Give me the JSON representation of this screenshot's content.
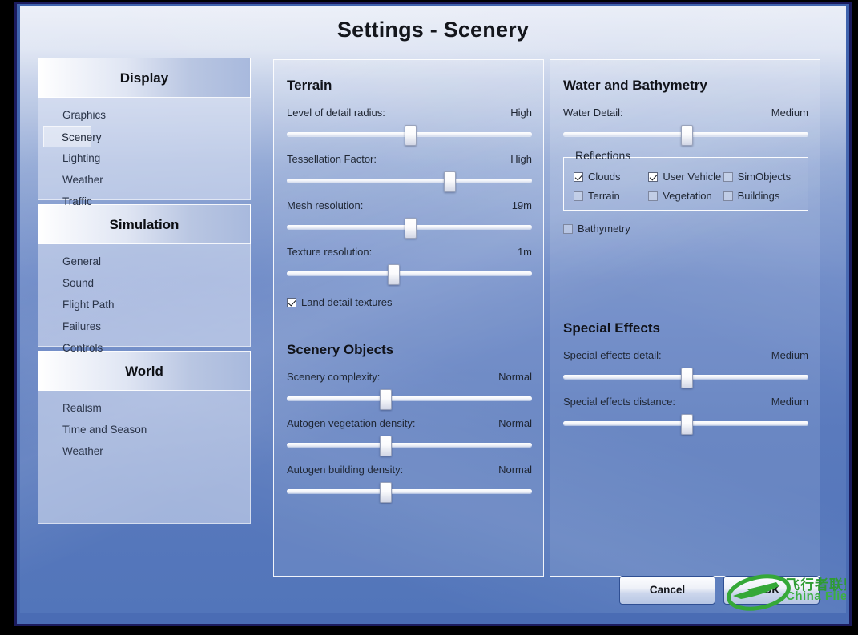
{
  "window": {
    "title": "Settings - Scenery"
  },
  "sidebar": {
    "groups": [
      {
        "header": "Display",
        "items": [
          {
            "label": "Graphics",
            "selected": false
          },
          {
            "label": "Scenery",
            "selected": true
          },
          {
            "label": "Lighting",
            "selected": false
          },
          {
            "label": "Weather",
            "selected": false
          },
          {
            "label": "Traffic",
            "selected": false
          }
        ]
      },
      {
        "header": "Simulation",
        "items": [
          {
            "label": "General",
            "selected": false
          },
          {
            "label": "Sound",
            "selected": false
          },
          {
            "label": "Flight Path",
            "selected": false
          },
          {
            "label": "Failures",
            "selected": false
          },
          {
            "label": "Controls",
            "selected": false
          }
        ]
      },
      {
        "header": "World",
        "items": [
          {
            "label": "Realism",
            "selected": false
          },
          {
            "label": "Time and Season",
            "selected": false
          },
          {
            "label": "Weather",
            "selected": false
          }
        ]
      }
    ]
  },
  "terrain": {
    "title": "Terrain",
    "sliders": [
      {
        "label": "Level of detail radius:",
        "value": "High",
        "pos": 50
      },
      {
        "label": "Tessellation Factor:",
        "value": "High",
        "pos": 66
      },
      {
        "label": "Mesh resolution:",
        "value": "19m",
        "pos": 50
      },
      {
        "label": "Texture resolution:",
        "value": "1m",
        "pos": 43
      }
    ],
    "checkbox": {
      "label": "Land detail textures",
      "checked": true
    }
  },
  "scenery_objects": {
    "title": "Scenery Objects",
    "sliders": [
      {
        "label": "Scenery complexity:",
        "value": "Normal",
        "pos": 40
      },
      {
        "label": "Autogen vegetation density:",
        "value": "Normal",
        "pos": 40
      },
      {
        "label": "Autogen building density:",
        "value": "Normal",
        "pos": 40
      }
    ]
  },
  "water": {
    "title": "Water and Bathymetry",
    "slider": {
      "label": "Water Detail:",
      "value": "Medium",
      "pos": 50
    },
    "reflections": {
      "legend": "Reflections",
      "items": [
        {
          "label": "Clouds",
          "checked": true
        },
        {
          "label": "User Vehicle",
          "checked": true
        },
        {
          "label": "SimObjects",
          "checked": false
        },
        {
          "label": "Terrain",
          "checked": false
        },
        {
          "label": "Vegetation",
          "checked": false
        },
        {
          "label": "Buildings",
          "checked": false
        }
      ]
    },
    "bathymetry": {
      "label": "Bathymetry",
      "checked": false
    }
  },
  "special_effects": {
    "title": "Special Effects",
    "sliders": [
      {
        "label": "Special effects detail:",
        "value": "Medium",
        "pos": 50
      },
      {
        "label": "Special effects distance:",
        "value": "Medium",
        "pos": 50
      }
    ]
  },
  "footer": {
    "cancel_label": "Cancel",
    "ok_label": "OK"
  },
  "watermark": {
    "text_cn": "飞行者联盟",
    "text_en": "China Flier",
    "color": "#3cb043"
  }
}
